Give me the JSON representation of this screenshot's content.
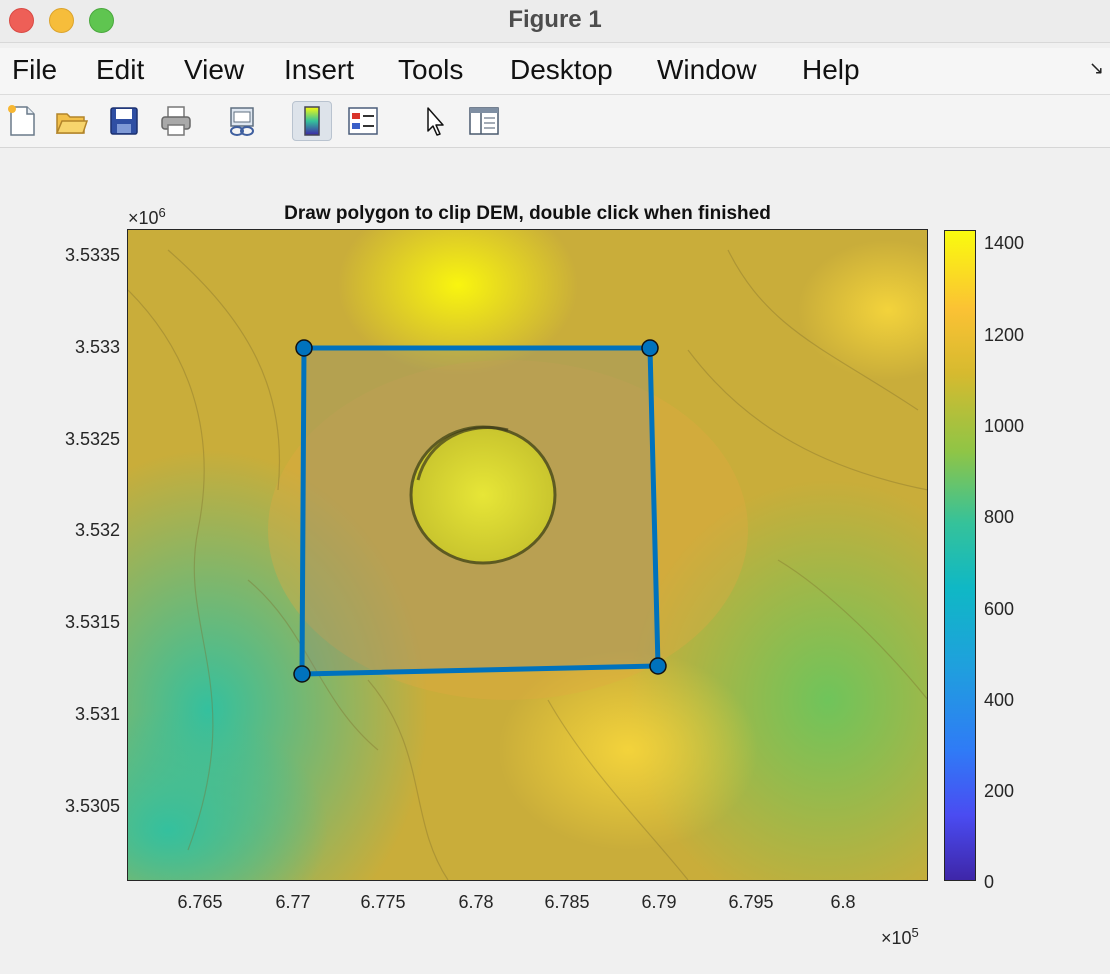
{
  "window": {
    "title": "Figure 1"
  },
  "menu": {
    "file": "File",
    "edit": "Edit",
    "view": "View",
    "insert": "Insert",
    "tools": "Tools",
    "desktop": "Desktop",
    "window": "Window",
    "help": "Help"
  },
  "toolbar_icons": [
    "new-figure-icon",
    "open-file-icon",
    "save-icon",
    "print-icon",
    "link-plot-icon",
    "colorbar-icon",
    "legend-icon",
    "edit-plot-arrow-icon",
    "property-inspector-icon"
  ],
  "plot": {
    "title": "Draw polygon to clip DEM, double click when finished",
    "y_multiplier_base": "×10",
    "y_multiplier_exp": "6",
    "x_multiplier_base": "×10",
    "x_multiplier_exp": "5",
    "y_ticks": [
      "3.5335",
      "3.533",
      "3.5325",
      "3.532",
      "3.5315",
      "3.531",
      "3.5305"
    ],
    "x_ticks": [
      "6.765",
      "6.77",
      "6.775",
      "6.78",
      "6.785",
      "6.79",
      "6.795",
      "6.8"
    ],
    "colorbar_ticks": [
      "1400",
      "1200",
      "1000",
      "800",
      "600",
      "400",
      "200",
      "0"
    ]
  },
  "chart_data": {
    "type": "heatmap",
    "title": "Draw polygon to clip DEM, double click when finished",
    "x_ticks_values": [
      676500,
      677000,
      677500,
      678000,
      678500,
      679000,
      679500,
      680000
    ],
    "y_ticks_values": [
      3533500,
      3533000,
      3532500,
      3532000,
      3531500,
      3531000,
      3530500
    ],
    "xlim": [
      676100,
      680450
    ],
    "ylim": [
      3530050,
      3533650
    ],
    "colorbar": {
      "min": 0,
      "max": 1420,
      "ticks": [
        0,
        200,
        400,
        600,
        800,
        1000,
        1200,
        1400
      ],
      "colormap": "parula"
    },
    "polygon": [
      {
        "x": 677050,
        "y": 3533000
      },
      {
        "x": 678950,
        "y": 3533000
      },
      {
        "x": 678990,
        "y": 3531270
      },
      {
        "x": 677040,
        "y": 3531220
      }
    ],
    "polygon_color": "#0072bd"
  }
}
